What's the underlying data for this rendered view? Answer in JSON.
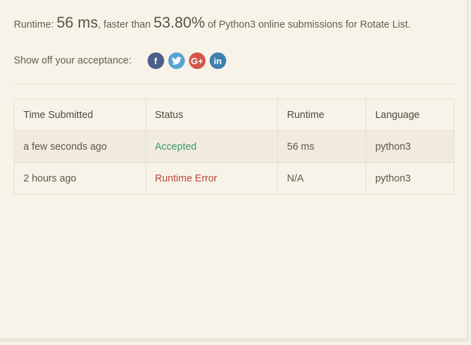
{
  "summary": {
    "runtime_label": "Runtime: ",
    "runtime_value": "56 ms",
    "faster_than_label": ", faster than ",
    "percentile": "53.80%",
    "trailing_text": " of Python3 online submissions for Rotate List."
  },
  "share": {
    "label": "Show off your acceptance:",
    "icons": [
      {
        "name": "facebook-icon",
        "glyph": "f",
        "color": "#4a5f8c"
      },
      {
        "name": "twitter-icon",
        "glyph": "",
        "color": "#58a2d4"
      },
      {
        "name": "google-plus-icon",
        "glyph": "G+",
        "color": "#d2574a"
      },
      {
        "name": "linkedin-icon",
        "glyph": "in",
        "color": "#3f7eae"
      }
    ]
  },
  "table": {
    "headers": [
      "Time Submitted",
      "Status",
      "Runtime",
      "Language"
    ],
    "rows": [
      {
        "time": "a few seconds ago",
        "status": "Accepted",
        "status_color": "#3a9a6b",
        "runtime": "56 ms",
        "language": "python3"
      },
      {
        "time": "2 hours ago",
        "status": "Runtime Error",
        "status_color": "#b34a3a",
        "runtime": "N/A",
        "language": "python3"
      }
    ]
  }
}
